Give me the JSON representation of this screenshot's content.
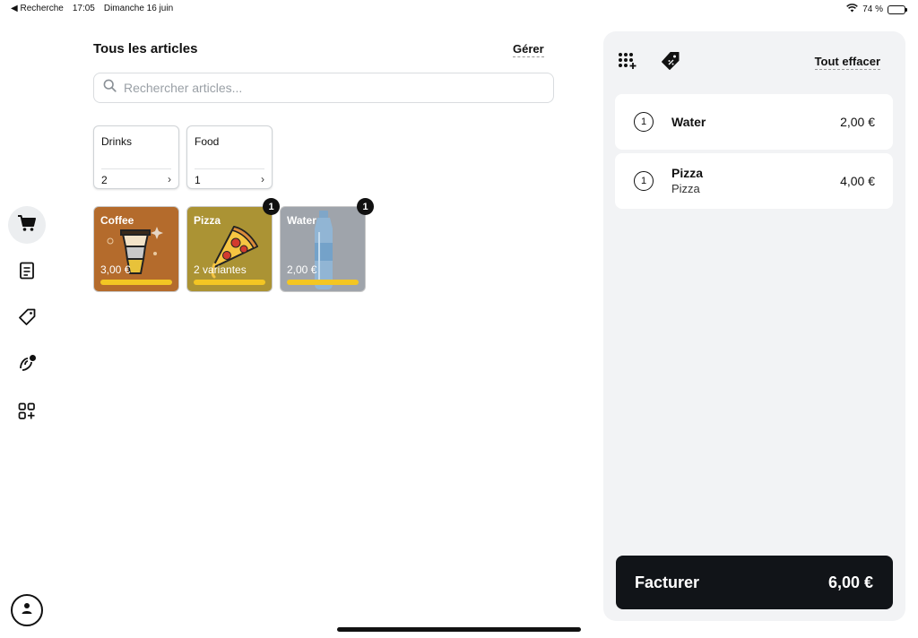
{
  "status_bar": {
    "back_label": "◀ Recherche",
    "time": "17:05",
    "date": "Dimanche 16 juin",
    "battery": "74 %",
    "battery_level": 0.74
  },
  "sidebar": {
    "items": [
      {
        "icon": "cart-icon",
        "active": true
      },
      {
        "icon": "receipt-icon",
        "active": false
      },
      {
        "icon": "tag-icon",
        "active": false
      },
      {
        "icon": "customers-icon",
        "active": false
      },
      {
        "icon": "apps-add-icon",
        "active": false
      }
    ],
    "profile_icon": "user-icon"
  },
  "main": {
    "title": "Tous les articles",
    "manage_label": "Gérer",
    "search_placeholder": "Rechercher articles...",
    "categories": [
      {
        "name": "Drinks",
        "count": "2",
        "chevron": "›"
      },
      {
        "name": "Food",
        "count": "1",
        "chevron": "›"
      }
    ],
    "items": [
      {
        "name": "Coffee",
        "subtitle": "3,00 €",
        "badge": "",
        "color": "#b46b2c"
      },
      {
        "name": "Pizza",
        "subtitle": "2 variantes",
        "badge": "1",
        "color": "#ab9334"
      },
      {
        "name": "Water",
        "subtitle": "2,00 €",
        "badge": "1",
        "color": "#9fa4ab"
      }
    ],
    "accent_bar_color": "#f3c623"
  },
  "cart": {
    "keypad_icon": "keypad-icon",
    "discount_icon": "discount-tag-icon",
    "clear_label": "Tout effacer",
    "lines": [
      {
        "qty": "1",
        "name": "Water",
        "variant": "",
        "price": "2,00 €"
      },
      {
        "qty": "1",
        "name": "Pizza",
        "variant": "Pizza",
        "price": "4,00 €"
      }
    ],
    "charge_label": "Facturer",
    "total": "6,00 €"
  }
}
